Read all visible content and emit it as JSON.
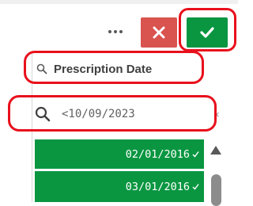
{
  "toolbar": {
    "more_icon": "more-horizontal-icon",
    "cancel_icon": "close-icon",
    "confirm_icon": "checkmark-icon",
    "cancel_color": "#d9534f",
    "confirm_color": "#0a9641"
  },
  "field": {
    "title": "Prescription Date",
    "search_value": "<10/09/2023",
    "clear_glyph": "×"
  },
  "list": {
    "selected_color": "#0a9641",
    "items": [
      {
        "label": "02/01/2016",
        "selected": true
      },
      {
        "label": "03/01/2016",
        "selected": true
      }
    ]
  },
  "annotations": {
    "highlight_color": "#e8101c"
  }
}
